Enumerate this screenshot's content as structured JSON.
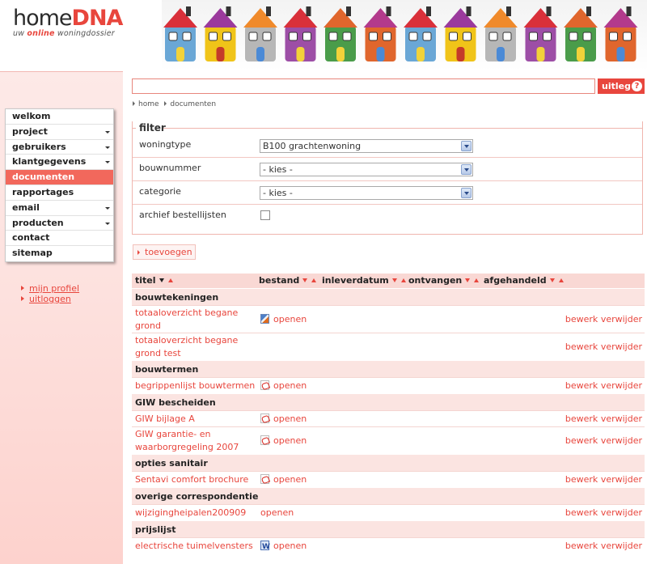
{
  "logo": {
    "home": "home",
    "dna": "DNA",
    "tagline_pre": "uw ",
    "tagline_online": "online",
    "tagline_post": " woningdossier"
  },
  "header_colors": {
    "brand": "#e8463d",
    "nav_active": "#f2685c",
    "header_row": "#f9d8d4",
    "group_row": "#fbe4e1"
  },
  "houses": [
    {
      "wall": "#6aa7d6",
      "roof": "#d9303a",
      "door": "#f2d23a"
    },
    {
      "wall": "#f0c419",
      "roof": "#9b3a9d",
      "door": "#c43a2a"
    },
    {
      "wall": "#b7b7b7",
      "roof": "#f08a2b",
      "door": "#4b8ad6"
    },
    {
      "wall": "#9d4ea6",
      "roof": "#d9303a",
      "door": "#f2d23a"
    },
    {
      "wall": "#4a9c4a",
      "roof": "#e0662d",
      "door": "#f2d23a"
    },
    {
      "wall": "#e0662d",
      "roof": "#b33a8c",
      "door": "#4b8ad6"
    },
    {
      "wall": "#6aa7d6",
      "roof": "#d9303a",
      "door": "#f2d23a"
    },
    {
      "wall": "#f0c419",
      "roof": "#9b3a9d",
      "door": "#c43a2a"
    },
    {
      "wall": "#b7b7b7",
      "roof": "#f08a2b",
      "door": "#4b8ad6"
    },
    {
      "wall": "#9d4ea6",
      "roof": "#d9303a",
      "door": "#f2d23a"
    },
    {
      "wall": "#4a9c4a",
      "roof": "#e0662d",
      "door": "#f2d23a"
    },
    {
      "wall": "#e0662d",
      "roof": "#b33a8c",
      "door": "#4b8ad6"
    }
  ],
  "nav": [
    {
      "label": "welkom",
      "caret": false,
      "active": false
    },
    {
      "label": "project",
      "caret": true,
      "active": false
    },
    {
      "label": "gebruikers",
      "caret": true,
      "active": false
    },
    {
      "label": "klantgegevens",
      "caret": true,
      "active": false
    },
    {
      "label": "documenten",
      "caret": false,
      "active": true
    },
    {
      "label": "rapportages",
      "caret": false,
      "active": false
    },
    {
      "label": "email",
      "caret": true,
      "active": false
    },
    {
      "label": "producten",
      "caret": true,
      "active": false
    },
    {
      "label": "contact",
      "caret": false,
      "active": false
    },
    {
      "label": "sitemap",
      "caret": false,
      "active": false
    }
  ],
  "user_links": [
    "mijn profiel",
    "uitloggen"
  ],
  "search": {
    "value": "",
    "placeholder": ""
  },
  "help_button": {
    "label": "uitleg",
    "icon": "?"
  },
  "breadcrumb": [
    "home",
    "documenten"
  ],
  "filter": {
    "legend": "filter",
    "rows": [
      {
        "label": "woningtype",
        "type": "select",
        "value": "B100 grachtenwoning"
      },
      {
        "label": "bouwnummer",
        "type": "select",
        "value": "- kies -"
      },
      {
        "label": "categorie",
        "type": "select",
        "value": "- kies -"
      },
      {
        "label": "archief bestellijsten",
        "type": "checkbox",
        "checked": false
      }
    ]
  },
  "add_button": "toevoegen",
  "table": {
    "columns": [
      {
        "label": "titel",
        "sort_down_dark": true
      },
      {
        "label": "bestand",
        "sort_down_dark": false
      },
      {
        "label": "inleverdatum",
        "sort_down_dark": false
      },
      {
        "label": "ontvangen",
        "sort_down_dark": false
      },
      {
        "label": "afgehandeld",
        "sort_down_dark": false
      }
    ],
    "open_label": "openen",
    "edit_label": "bewerk",
    "delete_label": "verwijder",
    "groups": [
      {
        "name": "bouwtekeningen",
        "items": [
          {
            "title": "totaaloverzicht begane grond",
            "file": "img",
            "tall": true
          },
          {
            "title": "totaaloverzicht begane grond test",
            "file": "",
            "tall": true
          }
        ]
      },
      {
        "name": "bouwtermen",
        "items": [
          {
            "title": "begrippenlijst bouwtermen",
            "file": "pdf",
            "tall": false
          }
        ]
      },
      {
        "name": "GIW bescheiden",
        "items": [
          {
            "title": "GIW bijlage A",
            "file": "pdf",
            "tall": false
          },
          {
            "title": "GIW garantie- en waarborgregeling 2007",
            "file": "pdf",
            "tall": true
          }
        ]
      },
      {
        "name": "opties sanitair",
        "items": [
          {
            "title": "Sentavi comfort brochure",
            "file": "pdf",
            "tall": false
          }
        ]
      },
      {
        "name": "overige correspondentie",
        "items": [
          {
            "title": "wijzigingheipalen200909",
            "file": "none",
            "tall": false
          }
        ]
      },
      {
        "name": "prijslijst",
        "items": [
          {
            "title": "electrische tuimelvensters",
            "file": "doc",
            "tall": false
          }
        ]
      }
    ]
  }
}
